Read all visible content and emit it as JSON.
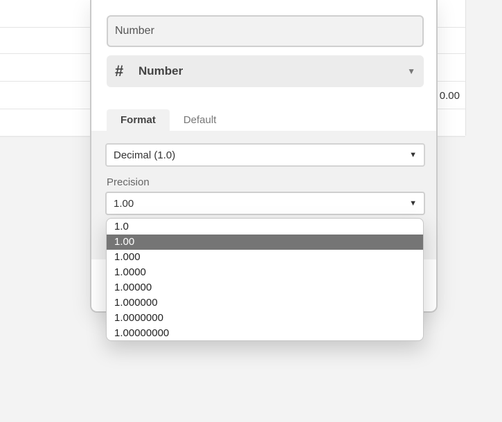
{
  "grid": {
    "visible_value": "0.00"
  },
  "dialog": {
    "name_input_value": "Number",
    "field_type": {
      "icon": "hash-icon",
      "label": "Number"
    },
    "tabs": [
      {
        "label": "Format",
        "active": true
      },
      {
        "label": "Default",
        "active": false
      }
    ],
    "format": {
      "selected": "Decimal (1.0)"
    },
    "precision": {
      "label": "Precision",
      "selected": "1.00",
      "options": [
        "1.0",
        "1.00",
        "1.000",
        "1.0000",
        "1.00000",
        "1.000000",
        "1.0000000",
        "1.00000000"
      ],
      "highlighted_index": 1
    }
  },
  "colors": {
    "highlight": "#757575",
    "accent": "#2d7ff9"
  }
}
